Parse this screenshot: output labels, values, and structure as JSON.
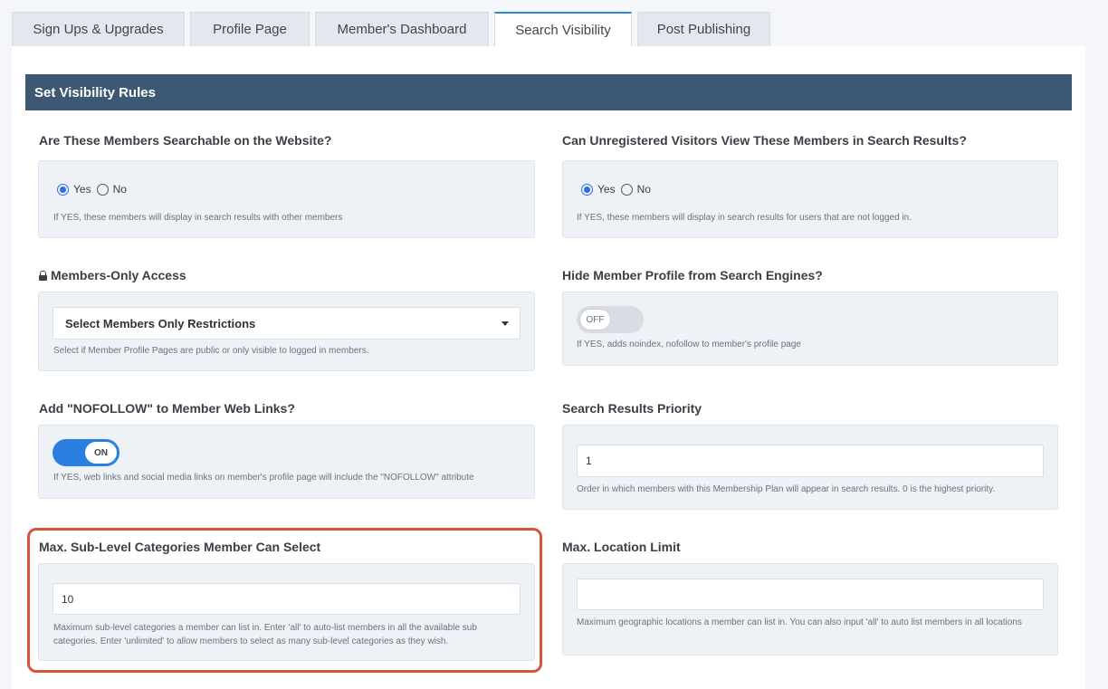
{
  "tabs": [
    {
      "label": "Sign Ups & Upgrades",
      "active": false
    },
    {
      "label": "Profile Page",
      "active": false
    },
    {
      "label": "Member's Dashboard",
      "active": false
    },
    {
      "label": "Search Visibility",
      "active": true
    },
    {
      "label": "Post Publishing",
      "active": false
    }
  ],
  "section": {
    "title": "Set Visibility Rules"
  },
  "fields": {
    "searchable": {
      "label": "Are These Members Searchable on the Website?",
      "options": [
        "Yes",
        "No"
      ],
      "selected": "Yes",
      "help": "If YES, these members will display in search results with other members"
    },
    "unregistered": {
      "label": "Can Unregistered Visitors View These Members in Search Results?",
      "options": [
        "Yes",
        "No"
      ],
      "selected": "Yes",
      "help": "If YES, these members will display in search results for users that are not logged in."
    },
    "members_only": {
      "label": "Members-Only Access",
      "icon": "lock-icon",
      "select_value": "Select Members Only Restrictions",
      "help": "Select if Member Profile Pages are public or only visible to logged in members."
    },
    "hide_profile": {
      "label": "Hide Member Profile from Search Engines?",
      "toggle_state": "OFF",
      "help": "If YES, adds noindex, nofollow to member's profile page"
    },
    "nofollow": {
      "label": "Add \"NOFOLLOW\" to Member Web Links?",
      "toggle_state": "ON",
      "help": "If YES, web links and social media links on member's profile page will include the \"NOFOLLOW\" attribute"
    },
    "priority": {
      "label": "Search Results Priority",
      "value": "1",
      "help": "Order in which members with this Membership Plan will appear in search results. 0 is the highest priority."
    },
    "sub_categories": {
      "label": "Max. Sub-Level Categories Member Can Select",
      "value": "10",
      "help": "Maximum sub-level categories a member can list in. Enter 'all' to auto-list members in all the available sub categories. Enter 'unlimited' to allow members to select as many sub-level categories as they wish."
    },
    "location_limit": {
      "label": "Max. Location Limit",
      "value": "",
      "help": "Maximum geographic locations a member can list in. You can also input 'all' to auto list members in all locations"
    }
  },
  "colors": {
    "header_bg": "#3d5872",
    "accent": "#2a7fe0",
    "highlight": "#d9533b",
    "active_tab_border": "#2d89c8"
  }
}
